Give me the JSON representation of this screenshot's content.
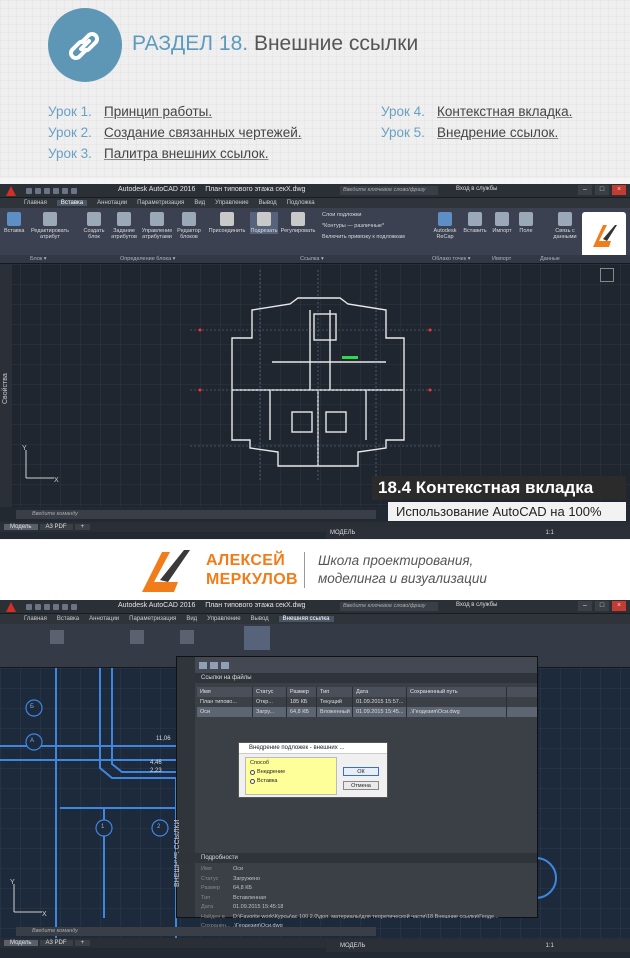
{
  "header": {
    "section_label": "РАЗДЕЛ 18.",
    "section_title": "Внешние ссылки",
    "icon": "chain-link-icon",
    "accent_color": "#5d97b5",
    "lessons": [
      {
        "num": "Урок 1.",
        "title": "Принцип работы."
      },
      {
        "num": "Урок 2.",
        "title": "Создание связанных чертежей."
      },
      {
        "num": "Урок 3.",
        "title": "Палитра внешних ссылок."
      },
      {
        "num": "Урок 4.",
        "title": "Контекстная вкладка."
      },
      {
        "num": "Урок 5.",
        "title": "Внедрение ссылок."
      }
    ]
  },
  "window1": {
    "app_title": "Autodesk AutoCAD 2016",
    "doc_title": "План типового этажа секХ.dwg",
    "search_placeholder": "Введите ключевое слово/фразу",
    "login": "Вход в службы",
    "tabs": [
      "Главная",
      "Вставка",
      "Аннотации",
      "Параметризация",
      "Вид",
      "Управление",
      "Вывод",
      "Подложка"
    ],
    "active_tab": "Вставка",
    "ribbon_buttons": [
      "Вставка",
      "Редактировать атрибут",
      "Создать блок",
      "Задание атрибутов",
      "Управление атрибутами",
      "Редактор блоков",
      "Присоединить",
      "Подрезать",
      "Регулировать",
      "Autodesk ReCap",
      "Вставить",
      "Импорт",
      "Поле",
      "Связь с данными"
    ],
    "ribbon_small": [
      "Слои подложки",
      "*Контуры — различные*",
      "Включить привязку к подложкам"
    ],
    "panel_names": [
      "Блок ▾",
      "Определение блока ▾",
      "Ссылка ▾",
      "Облако точек ▾",
      "Импорт",
      "Данные"
    ],
    "side_label": "Свойства",
    "command_placeholder": "Введите команду",
    "doc_tabs": [
      "Модель",
      "A3 PDF",
      "+"
    ],
    "status_model": "МОДЕЛЬ",
    "scale": "1:1",
    "caption_title": "18.4 Контекстная вкладка",
    "caption_sub": "Использование AutoCAD на 100%"
  },
  "brand": {
    "name_line1": "АЛЕКСЕЙ",
    "name_line2": "МЕРКУЛОВ",
    "tag_line1": "Школа проектирования,",
    "tag_line2": "моделинга и визуализации",
    "accent_color": "#f07d1a"
  },
  "window2": {
    "app_title": "Autodesk AutoCAD 2016",
    "doc_title": "План типового этажа секХ.dwg",
    "search_placeholder": "Введите ключевое слово/фразу",
    "login": "Вход в службы",
    "tabs": [
      "Главная",
      "Вставка",
      "Аннотации",
      "Параметризация",
      "Вид",
      "Управление",
      "Вывод",
      "Внешняя ссылка"
    ],
    "active_tab": "Внешняя ссылка",
    "palette_section": "Ссылки на файлы",
    "columns": [
      "Имя",
      "Статус",
      "Размер",
      "Тип",
      "Дата",
      "Сохраненный путь"
    ],
    "rows": [
      [
        "План типово...",
        "Откр...",
        "185 КБ",
        "Текущий",
        "01.09.2015 15:57...",
        ""
      ],
      [
        "Оси",
        "Загру...",
        "64,8 КБ",
        "Вложенный",
        "01.09.2015 15:45...",
        ".\\Геодезия\\Оси.dwg"
      ]
    ],
    "details_section": "Подробности",
    "details": [
      [
        "Имя",
        "Оси"
      ],
      [
        "Статус",
        "Загружено"
      ],
      [
        "Размер",
        "64,8 КБ"
      ],
      [
        "Тип",
        "Вставленная"
      ],
      [
        "Дата",
        "01.09.2015 15:45:18"
      ],
      [
        "Найден в",
        "D:\\Favorite work\\Курсы\\ac 100 2.0\\доп. материалы\\для теоретической части\\18.Внешние ссылки\\Геоде..."
      ],
      [
        "Сохранен...",
        ".\\Геодезия\\Оси.dwg"
      ]
    ],
    "palette_vertical_label": "ВНЕШНИЕ ССЫЛКИ",
    "dialog_title": "Внедрение подложек - внешних ...",
    "dialog_group": "Способ",
    "dialog_options": [
      "Внедрение",
      "Вставка"
    ],
    "dialog_ok": "ОК",
    "dialog_cancel": "Отмена",
    "dim_label1": "11,06",
    "dim_label2": "4,46",
    "dim_label3": "2,23",
    "grid_marks": [
      "Б",
      "А",
      "1",
      "2"
    ],
    "command_placeholder": "Введите команду",
    "doc_tabs": [
      "Модель",
      "A3 PDF",
      "+"
    ],
    "status_model": "МОДЕЛЬ",
    "scale": "1:1"
  }
}
